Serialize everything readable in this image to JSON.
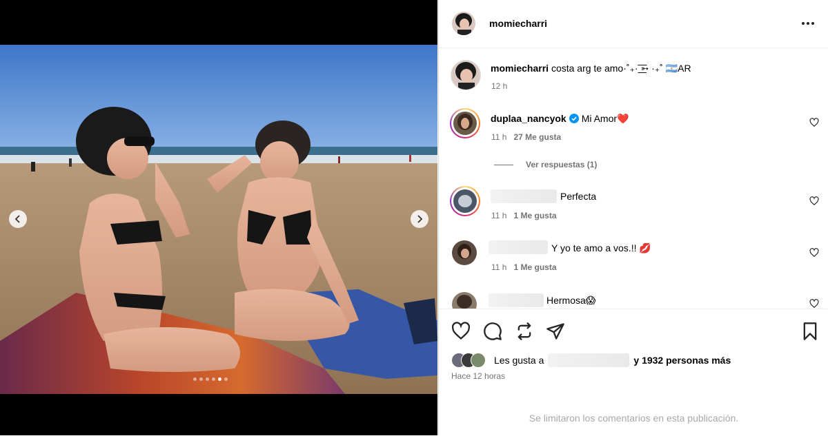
{
  "post": {
    "author": "momiecharri",
    "caption": "costa arg te amo·˚₊· ͟͟͞͞➳ ·₊˚ 🇦🇷AR",
    "caption_time": "12 h",
    "likes_prefix": "Les gusta a",
    "likes_suffix": "y 1932 personas más",
    "posted_ago": "Hace 12 horas",
    "comments_limited": "Se limitaron los comentarios en esta publicación."
  },
  "comments": [
    {
      "user": "duplaa_nancyok",
      "verified": true,
      "text": "Mi Amor❤️",
      "time": "11 h",
      "likes": "27 Me gusta",
      "replies": "Ver respuestas (1)"
    },
    {
      "user": "",
      "text": "Perfecta",
      "time": "11 h",
      "likes": "1 Me gusta"
    },
    {
      "user": "",
      "text": "Y yo te amo a vos.!! 💋",
      "time": "11 h",
      "likes": "1 Me gusta"
    },
    {
      "user": "",
      "text": "Hermosa😱"
    }
  ],
  "icons": {
    "more": "more-options-icon",
    "like": "heart-icon",
    "comment": "comment-icon",
    "share_repost": "repost-icon",
    "send": "send-icon",
    "save": "bookmark-icon"
  },
  "carousel": {
    "count": 6,
    "active": 4
  },
  "colors": {
    "verified": "#0095f6",
    "muted": "#737373",
    "divider": "#efefef"
  }
}
